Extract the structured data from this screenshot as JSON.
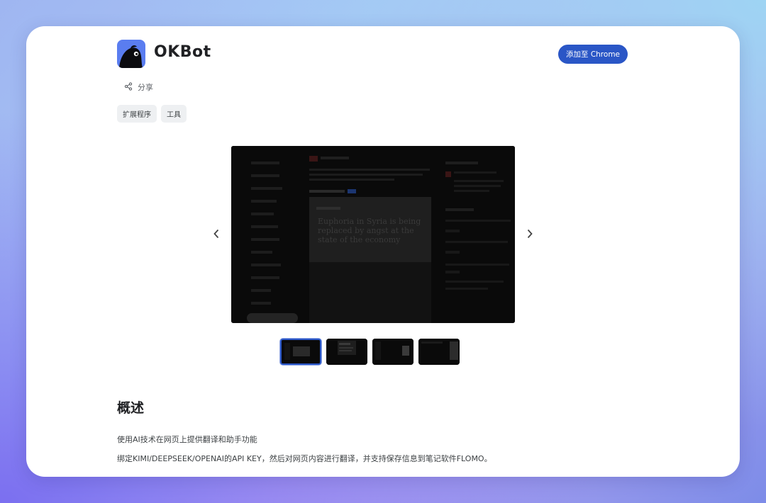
{
  "app": {
    "name": "OKBot",
    "add_button": "添加至 Chrome",
    "share": "分享"
  },
  "tags": [
    "扩展程序",
    "工具"
  ],
  "carousel": {
    "main_quote": "Euphoria in Syria is being replaced by angst at the state of the economy",
    "thumbnail_count": 4,
    "active_index": 0
  },
  "overview": {
    "title": "概述",
    "lines": [
      "使用AI技术在网页上提供翻译和助手功能",
      "绑定KIMI/DEEPSEEK/OPENAI的API KEY，然后对网页内容进行翻译，并支持保存信息到笔记软件FLOMO。"
    ]
  },
  "colors": {
    "accent": "#2a56c6",
    "logo_bg": "#5a7df0"
  }
}
